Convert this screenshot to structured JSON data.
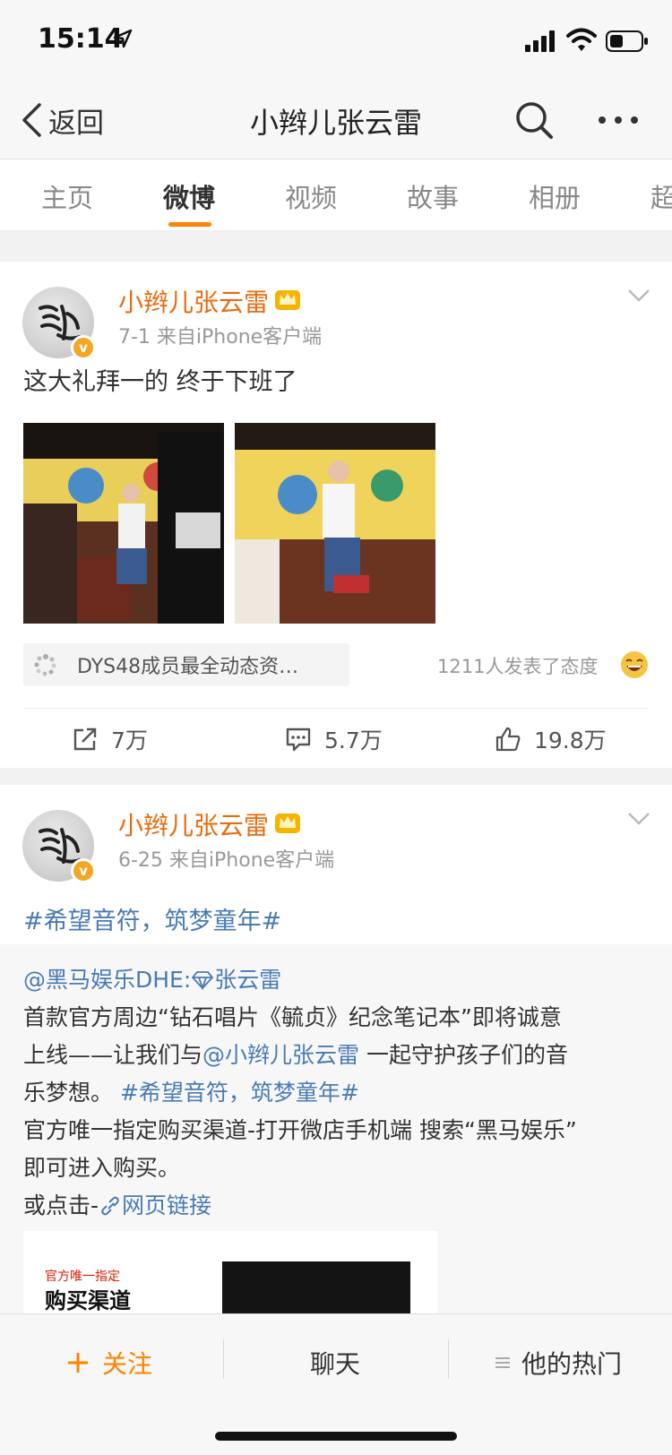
{
  "status_bar": {
    "time": "15:14"
  },
  "nav": {
    "back_label": "返回",
    "title": "小辫儿张云雷"
  },
  "tabs": [
    {
      "label": "主页"
    },
    {
      "label": "微博"
    },
    {
      "label": "视频"
    },
    {
      "label": "故事"
    },
    {
      "label": "相册"
    },
    {
      "label": "超"
    }
  ],
  "posts": [
    {
      "user_name": "小辫儿张云雷",
      "meta": "7-1  来自iPhone客户端",
      "text": "这大礼拜一的 终于下班了",
      "topic_chip": "DYS48成员最全动态资…",
      "reactions": "1211人发表了态度",
      "actions": {
        "repost": "7万",
        "comment": "5.7万",
        "like": "19.8万"
      }
    },
    {
      "user_name": "小辫儿张云雷",
      "meta": "6-25  来自iPhone客户端",
      "hashtag": "#希望音符，筑梦童年#",
      "repost": {
        "source_user": "@黑马娱乐DHE:",
        "mention_user": "张云雷",
        "line1": "首款官方周边“钻石唱片《毓贞》纪念笔记本”即将诚意",
        "line2_a": "上线——让我们与",
        "line2_mention": "@小辫儿张云雷",
        "line2_b": " 一起守护孩子们的音",
        "line3_a": "乐梦想。 ",
        "line3_tag": "#希望音符，筑梦童年#",
        "line4": "官方唯一指定购买渠道-打开微店手机端 搜索“黑马娱乐”",
        "line5": "即可进入购买。",
        "line6_a": "或点击-",
        "line6_link": "网页链接",
        "image_caption_red": "官方唯一指定",
        "image_caption_black": "购买渠道"
      }
    }
  ],
  "bottom_bar": {
    "follow": "关注",
    "chat": "聊天",
    "hot": "他的热门"
  },
  "colors": {
    "accent": "#ff8200",
    "username": "#e86b0f",
    "link": "#4a7bb4"
  }
}
